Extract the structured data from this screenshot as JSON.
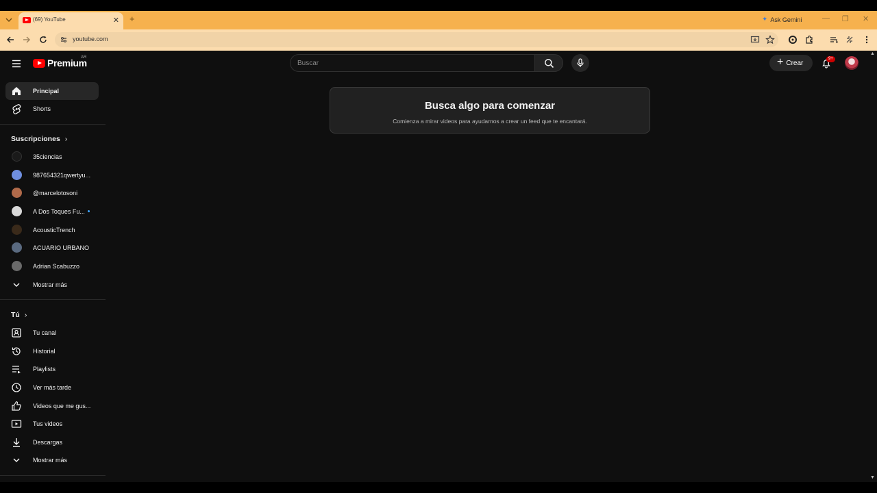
{
  "browser": {
    "tab_title": "(69) YouTube",
    "tab_close": "✕",
    "new_tab": "+",
    "gemini_label": "Ask Gemini",
    "url": "youtube.com",
    "window_controls": [
      "—",
      "❐",
      "✕"
    ]
  },
  "header": {
    "logo_text": "Premium",
    "country_code": "AR",
    "search_placeholder": "Buscar",
    "create_label": "Crear",
    "notification_badge": "9+"
  },
  "sidebar": {
    "main": [
      {
        "label": "Principal",
        "icon": "home-icon",
        "active": true
      },
      {
        "label": "Shorts",
        "icon": "shorts-icon",
        "active": false
      }
    ],
    "subscriptions_heading": "Suscripciones",
    "subscriptions": [
      {
        "label": "35ciencias",
        "color": "#1a1a1a"
      },
      {
        "label": "987654321qwertyu...",
        "color": "#6f8fe0"
      },
      {
        "label": "@marcelotosoni",
        "color": "#b06a4a"
      },
      {
        "label": "A Dos Toques Fu...",
        "color": "#d9d9d9",
        "new_content": true
      },
      {
        "label": "AcousticTrench",
        "color": "#3a2a1a"
      },
      {
        "label": "ACUARIO URBANO",
        "color": "#5a6a80"
      },
      {
        "label": "Adrian Scabuzzo",
        "color": "#6a6a6a"
      }
    ],
    "subscriptions_more": "Mostrar más",
    "you_heading": "Tú",
    "you": [
      {
        "label": "Tu canal",
        "icon": "channel-icon"
      },
      {
        "label": "Historial",
        "icon": "history-icon"
      },
      {
        "label": "Playlists",
        "icon": "playlists-icon"
      },
      {
        "label": "Ver más tarde",
        "icon": "watch-later-icon"
      },
      {
        "label": "Videos que me gus...",
        "icon": "like-icon"
      },
      {
        "label": "Tus videos",
        "icon": "your-videos-icon"
      },
      {
        "label": "Descargas",
        "icon": "download-icon"
      }
    ],
    "you_more": "Mostrar más"
  },
  "main": {
    "empty_title": "Busca algo para comenzar",
    "empty_subtitle": "Comienza a mirar videos para ayudarnos a crear un feed que te encantará."
  }
}
